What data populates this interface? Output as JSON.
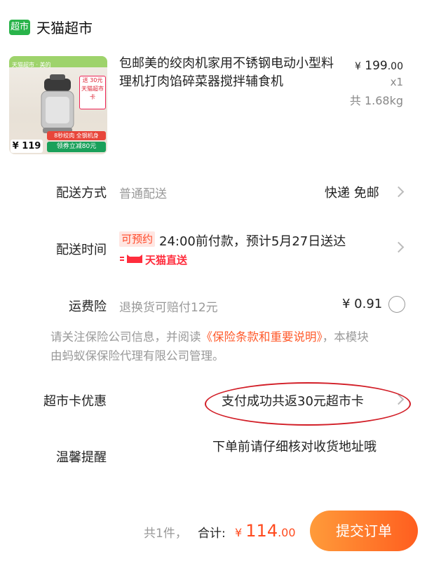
{
  "store": {
    "badge": "超市",
    "name": "天猫超市"
  },
  "product": {
    "title": "包邮美的绞肉机家用不锈钢电动小型料理机打肉馅碎菜器搅拌辅食机",
    "price_symbol": "¥",
    "price_int": "199",
    "price_dec": ".00",
    "qty": "x1",
    "weight": "共 1.68kg",
    "thumb": {
      "strip": "天猫超市 · 美的",
      "price": "¥ 119",
      "promo": "8秒绞肉 全钢机身",
      "coupon": "领券立减80元",
      "tag": "送 30元 天猫超市卡"
    }
  },
  "delivery_method": {
    "label": "配送方式",
    "value": "普通配送",
    "right": "快递 免邮"
  },
  "delivery_time": {
    "label": "配送时间",
    "badge": "可预约",
    "text": "24:00前付款，预计5月27日送达",
    "service": "天猫直送"
  },
  "insurance": {
    "label": "运费险",
    "desc": "退换货可赔付12元",
    "price": "¥ 0.91"
  },
  "notice": {
    "pre": "请关注保险公司信息，并阅读",
    "link": "《保险条款和重要说明》",
    "post": "，本模块由蚂蚁保保险代理有限公司管理。"
  },
  "card_discount": {
    "label": "超市卡优惠",
    "value": "支付成功共返30元超市卡"
  },
  "reminder": {
    "label": "温馨提醒",
    "text": "下单前请仔细核对收货地址哦"
  },
  "footer": {
    "count": "共1件，",
    "total_label": "合计:",
    "symbol": "¥",
    "total_int": "114",
    "total_dec": ".00",
    "submit": "提交订单"
  }
}
